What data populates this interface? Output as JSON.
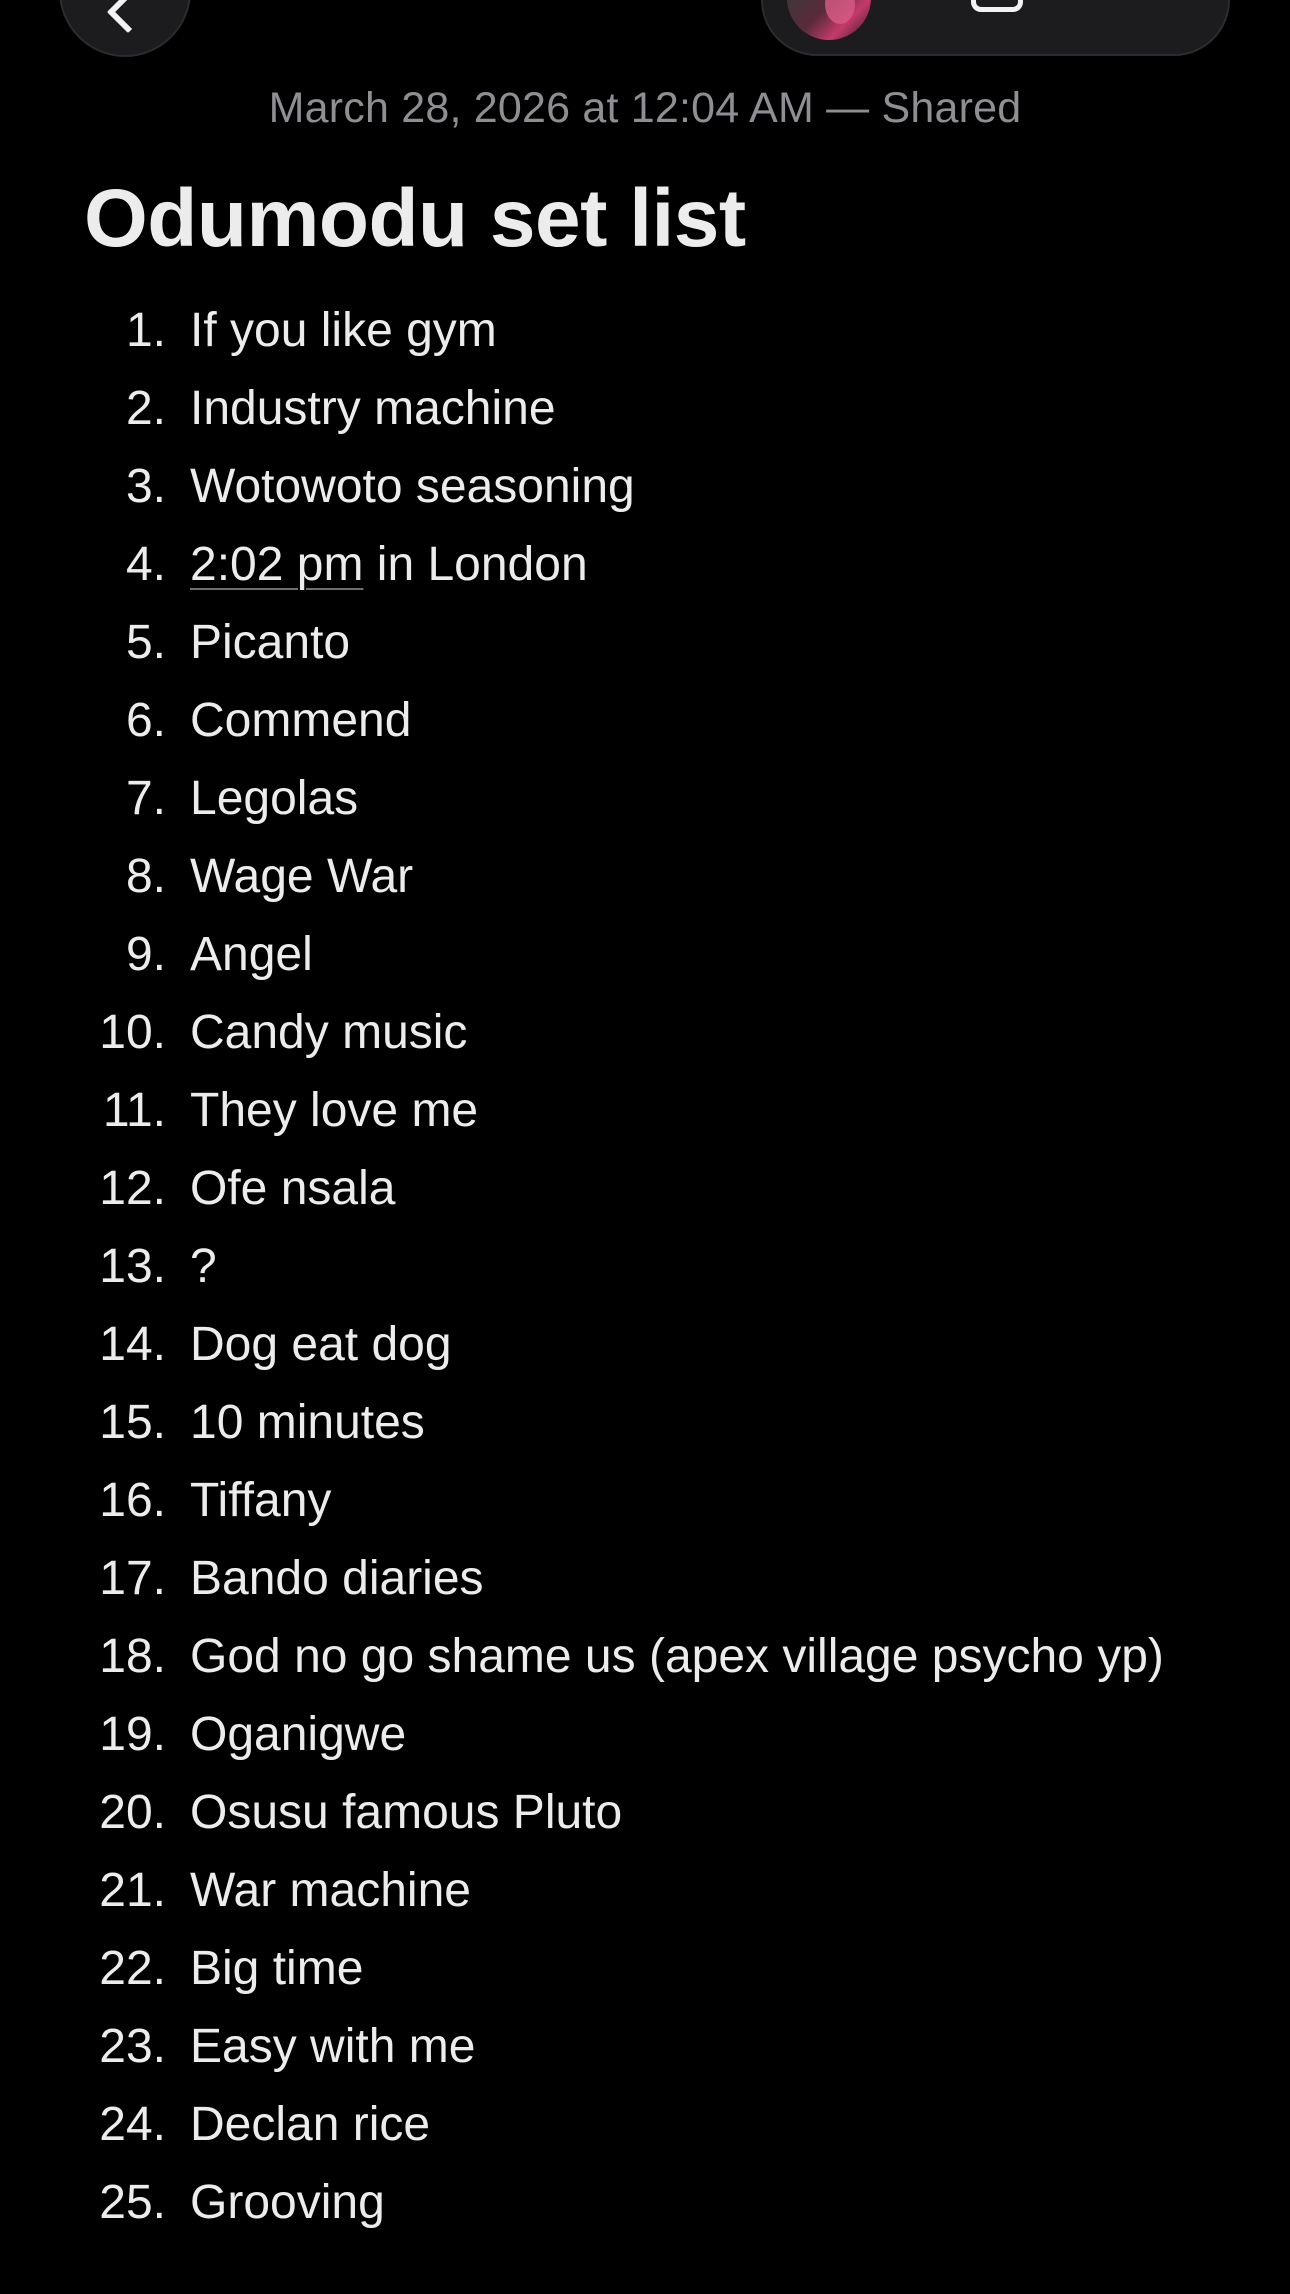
{
  "note": {
    "meta": "March 28, 2026 at 12:04 AM — Shared",
    "title": "Odumodu set list",
    "items": [
      {
        "n": "1.",
        "text": "If you like gym"
      },
      {
        "n": "2.",
        "text": "Industry machine"
      },
      {
        "n": "3.",
        "text": "Wotowoto seasoning"
      },
      {
        "n": "4.",
        "link": "2:02 pm",
        "rest": " in London"
      },
      {
        "n": "5.",
        "text": "Picanto"
      },
      {
        "n": "6.",
        "text": "Commend"
      },
      {
        "n": "7.",
        "text": "Legolas"
      },
      {
        "n": "8.",
        "text": "Wage War"
      },
      {
        "n": "9.",
        "text": "Angel"
      },
      {
        "n": "10.",
        "text": "Candy music"
      },
      {
        "n": "11.",
        "text": "They love me"
      },
      {
        "n": "12.",
        "text": "Ofe nsala"
      },
      {
        "n": "13.",
        "text": "?"
      },
      {
        "n": "14.",
        "text": "Dog eat dog"
      },
      {
        "n": "15.",
        "text": "10 minutes"
      },
      {
        "n": "16.",
        "text": "Tiffany"
      },
      {
        "n": "17.",
        "text": "Bando diaries"
      },
      {
        "n": "18.",
        "text": "God no go shame us (apex village psycho yp)"
      },
      {
        "n": "19.",
        "text": "Oganigwe"
      },
      {
        "n": "20.",
        "text": "Osusu famous Pluto"
      },
      {
        "n": "21.",
        "text": "War machine"
      },
      {
        "n": "22.",
        "text": "Big time"
      },
      {
        "n": "23.",
        "text": "Easy with me"
      },
      {
        "n": "24.",
        "text": "Declan rice"
      },
      {
        "n": "25.",
        "text": "Grooving"
      }
    ]
  },
  "icons": {
    "back": "chevron-left-icon",
    "share": "share-icon"
  },
  "colors": {
    "background": "#000000",
    "text": "#ececec",
    "meta": "#8e8e93",
    "button": "#1c1c1e"
  }
}
